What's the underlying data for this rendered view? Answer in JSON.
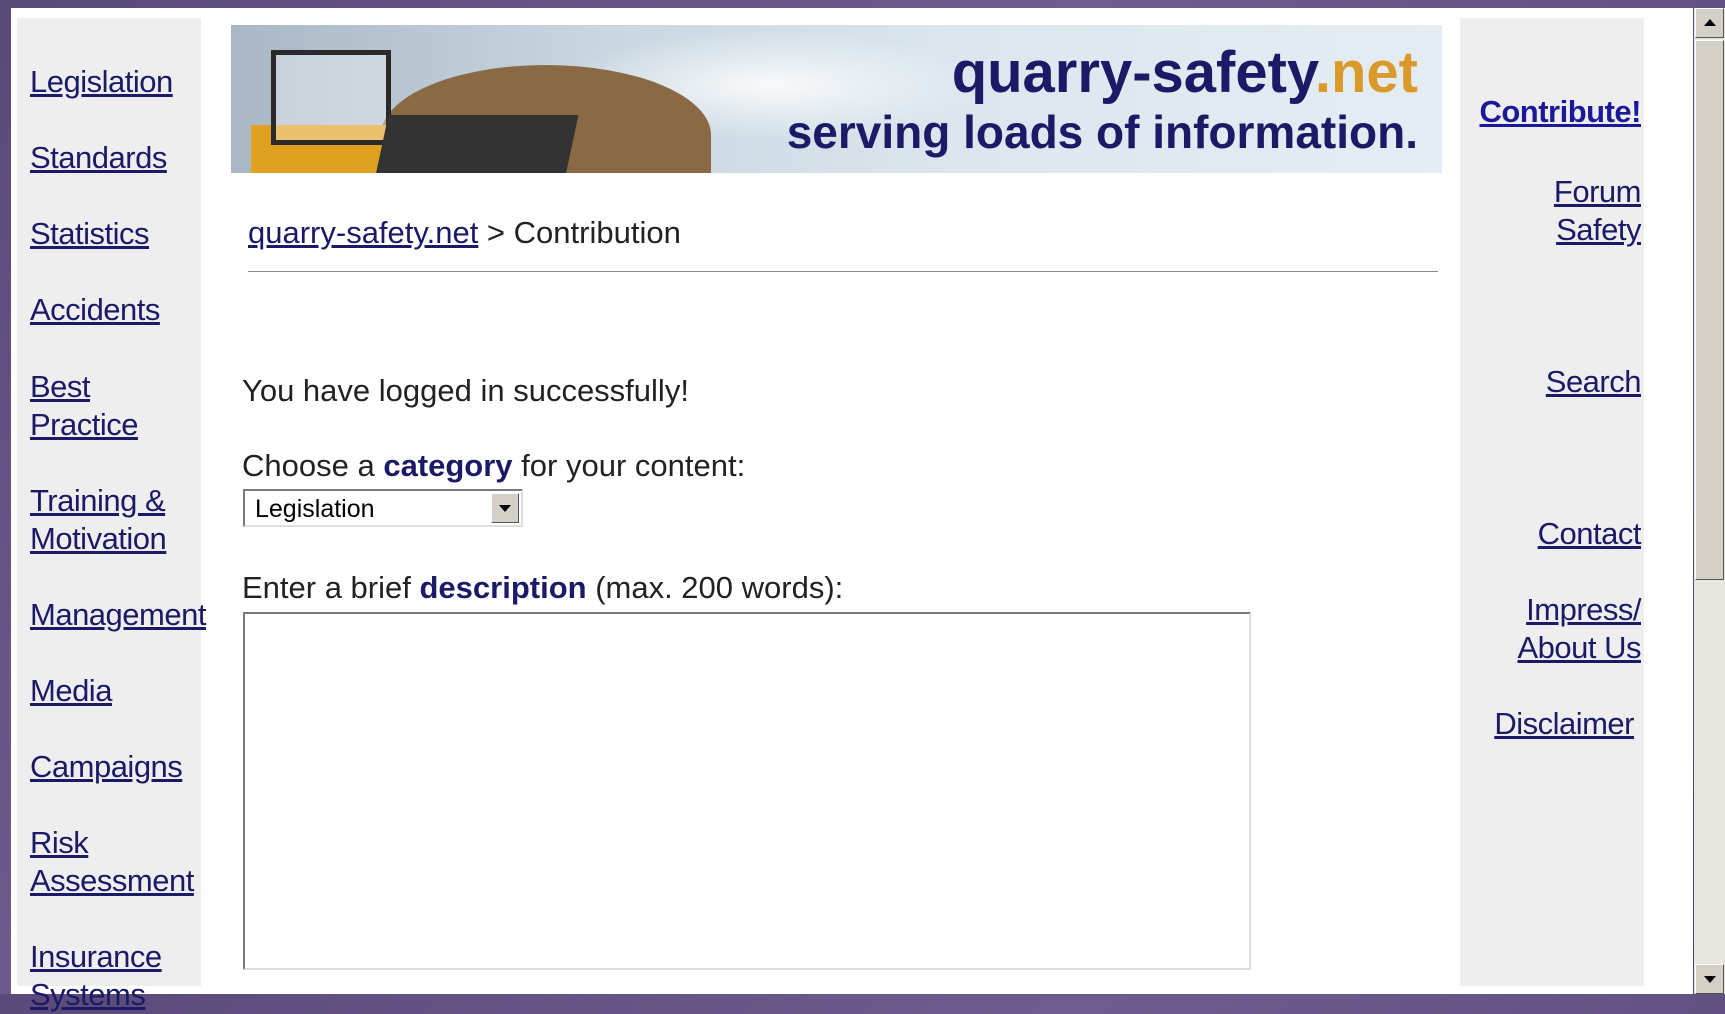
{
  "left_nav": {
    "items": [
      {
        "label_lines": [
          "Legislation"
        ]
      },
      {
        "label_lines": [
          "Standards"
        ]
      },
      {
        "label_lines": [
          "Statistics"
        ]
      },
      {
        "label_lines": [
          "Accidents"
        ]
      },
      {
        "label_lines": [
          "Best",
          "Practice"
        ]
      },
      {
        "label_lines": [
          "Training &",
          "Motivation"
        ]
      },
      {
        "label_lines": [
          "Management"
        ]
      },
      {
        "label_lines": [
          "Media"
        ]
      },
      {
        "label_lines": [
          "Campaigns"
        ]
      },
      {
        "label_lines": [
          "Risk",
          "Assessment"
        ]
      },
      {
        "label_lines": [
          "Insurance",
          "Systems"
        ]
      }
    ]
  },
  "banner": {
    "site_name_main": "quarry-safety",
    "site_name_tld": ".net",
    "tagline": "serving loads of information."
  },
  "breadcrumb": {
    "home_link": "quarry-safety.net",
    "separator": " > ",
    "current": "Contribution"
  },
  "main": {
    "success_message": "You have logged in successfully!",
    "category_label_before": "Choose a ",
    "category_label_bold": "category",
    "category_label_after": " for your content:",
    "category_selected": "Legislation",
    "description_label_before": "Enter a brief ",
    "description_label_bold": "description",
    "description_label_after": " (max. 200 words):",
    "description_value": ""
  },
  "right_nav": {
    "contribute": "Contribute!",
    "forum_line1": "Forum",
    "forum_line2": "Safety",
    "search": "Search",
    "contact": "Contact",
    "impress_line1": "Impress/",
    "impress_line2": "About Us",
    "disclaimer": "Disclaimer"
  },
  "colors": {
    "link": "#1a1a66",
    "tld_accent": "#d99a2b",
    "nav_bg": "#eeeeee"
  }
}
